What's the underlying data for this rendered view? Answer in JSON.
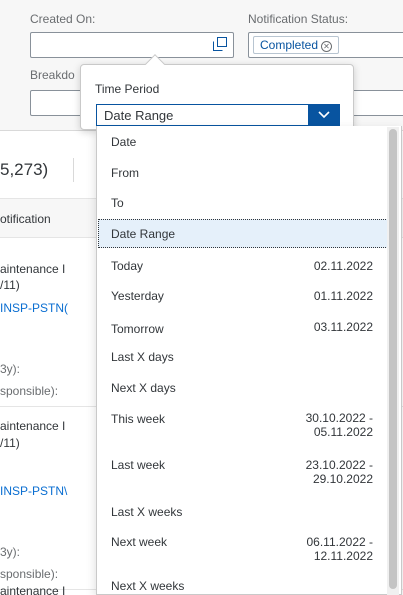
{
  "filters": {
    "created_on_label": "Created On:",
    "notification_status_label": "Notification Status:",
    "status_token": "Completed",
    "breakdown_label": "Breakdo"
  },
  "table": {
    "count": "5,273)",
    "col_notification": "otification",
    "rows": [
      {
        "line1": "aintenance I",
        "line2": "/11)",
        "link": "INSP-PSTN(",
        "by": "3y):",
        "resp": "sponsible):"
      },
      {
        "line1": "aintenance I",
        "line2": "/11)",
        "link": "INSP-PSTN\\",
        "by": "3y):",
        "resp": "sponsible):"
      },
      {
        "line1": "aintenance I"
      }
    ]
  },
  "popover": {
    "label": "Time Period",
    "selected": "Date Range"
  },
  "options": [
    {
      "label": "Date",
      "value": ""
    },
    {
      "label": "From",
      "value": ""
    },
    {
      "label": "To",
      "value": ""
    },
    {
      "label": "Date Range",
      "value": ""
    },
    {
      "label": "Today",
      "value": "02.11.2022"
    },
    {
      "label": "Yesterday",
      "value": "01.11.2022"
    },
    {
      "label": "Tomorrow",
      "value": "03.11.2022"
    },
    {
      "label": "Last X days",
      "value": ""
    },
    {
      "label": "Next X days",
      "value": ""
    },
    {
      "label": "This week",
      "value": "30.10.2022 - 05.11.2022"
    },
    {
      "label": "Last week",
      "value": "23.10.2022 - 29.10.2022"
    },
    {
      "label": "Last X weeks",
      "value": ""
    },
    {
      "label": "Next week",
      "value": "06.11.2022 - 12.11.2022"
    },
    {
      "label": "Next X weeks",
      "value": ""
    }
  ],
  "colors": {
    "brand_blue": "#0854a0",
    "link_blue": "#0a6ed1",
    "focus_bg": "#e5f0fa"
  }
}
